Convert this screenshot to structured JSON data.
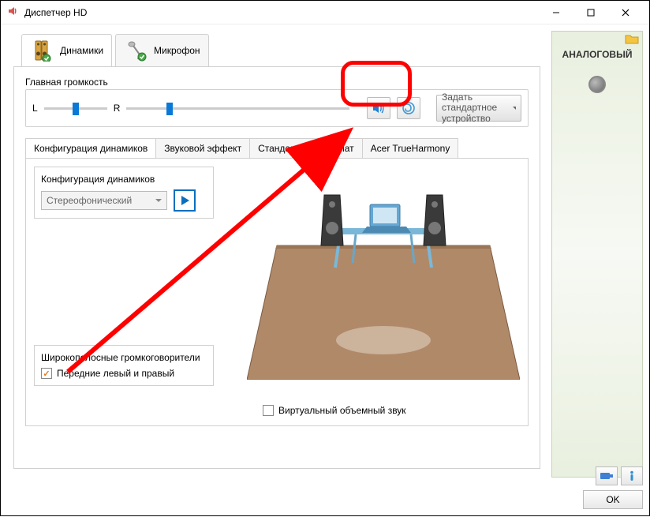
{
  "window": {
    "title": "Диспетчер HD"
  },
  "tabs": {
    "speakers": "Динамики",
    "microphone": "Микрофон"
  },
  "main_volume": {
    "title": "Главная громкость",
    "left_label": "L",
    "right_label": "R"
  },
  "default_device_btn": "Задать стандартное устройство",
  "sub_tabs": {
    "speaker_config": "Конфигурация динамиков",
    "sound_effect": "Звуковой эффект",
    "default_format": "Стандартный формат",
    "trueharmony": "Acer TrueHarmony"
  },
  "speaker_config_group": {
    "label": "Конфигурация динамиков",
    "value": "Стереофонический"
  },
  "wideband": {
    "title": "Широкополосные громкоговорители",
    "front_lr": "Передние левый и правый"
  },
  "virtual_surround": "Виртуальный объемный звук",
  "right_panel": {
    "analog": "АНАЛОГОВЫЙ"
  },
  "ok_button": "OK"
}
